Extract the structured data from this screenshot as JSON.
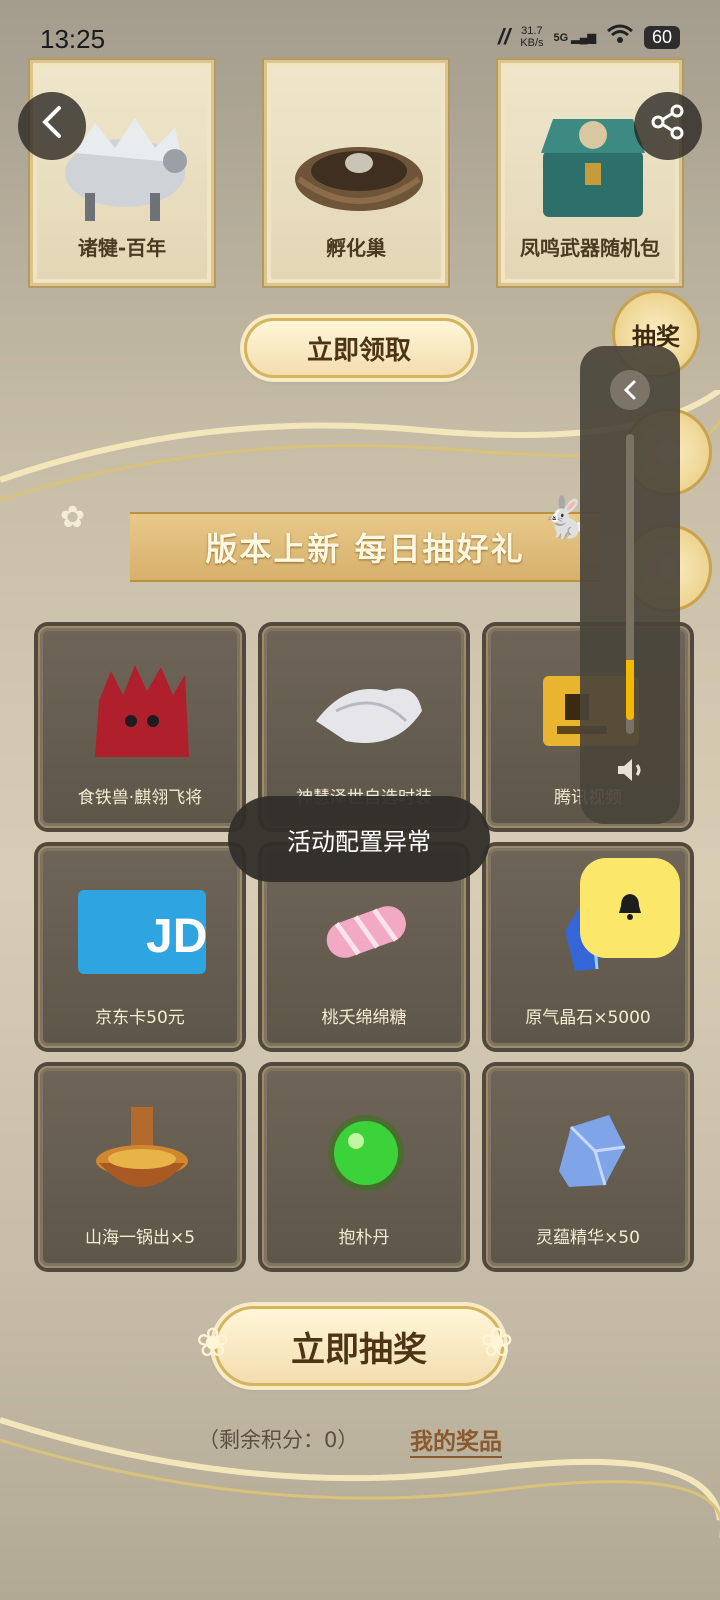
{
  "status_bar": {
    "time": "13:25",
    "net_speed_value": "31.7",
    "net_speed_unit": "KB/s",
    "network": "5G",
    "battery": "60"
  },
  "top_rewards": [
    {
      "label": "诸犍-百年",
      "icon": "beast-icon"
    },
    {
      "label": "孵化巢",
      "icon": "nest-icon"
    },
    {
      "label": "凤鸣武器随机包",
      "icon": "chest-icon"
    }
  ],
  "claim_button": "立即领取",
  "side_tabs": [
    {
      "label": "抽奖"
    }
  ],
  "section_title": "版本上新 每日抽好礼",
  "prizes": [
    {
      "label": "食铁兽·麒翎飞将",
      "icon": "red-beast-icon",
      "color": "#b0202c"
    },
    {
      "label": "神慧泽世自选时装",
      "icon": "white-costume-icon",
      "color": "#e6e6ea"
    },
    {
      "label": "腾讯视频",
      "icon": "tencent-card-icon",
      "color": "#e9b530"
    },
    {
      "label": "京东卡50元",
      "icon": "jd-card-icon",
      "color": "#2ea4e0"
    },
    {
      "label": "桃夭绵绵糖",
      "icon": "candy-icon",
      "color": "#f2a9c4"
    },
    {
      "label": "原气晶石×5000",
      "icon": "crystal-icon",
      "color": "#3566d8"
    },
    {
      "label": "山海一锅出×5",
      "icon": "hotpot-icon",
      "color": "#d0872f"
    },
    {
      "label": "抱朴丹",
      "icon": "green-pill-icon",
      "color": "#3bd23a"
    },
    {
      "label": "灵蕴精华×50",
      "icon": "blue-gem-icon",
      "color": "#7fa4e8"
    }
  ],
  "draw_button": "立即抽奖",
  "remaining_points": "（剩余积分：0）",
  "my_prizes": "我的奖品",
  "toast": "活动配置异常",
  "volume_level": 0.2,
  "accent": "#f5b800"
}
